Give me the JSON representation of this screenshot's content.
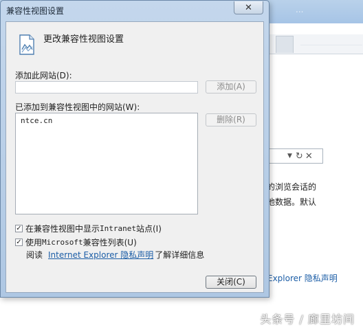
{
  "dialog": {
    "title": "兼容性视图设置",
    "close_icon": "close-icon",
    "header_icon": "document-icon",
    "header_text": "更改兼容性视图设置",
    "add_site_label": "添加此网站(D):",
    "add_site_value": "",
    "add_button": "添加(A)",
    "list_label": "已添加到兼容性视图中的网站(W):",
    "sites": [
      "ntce.cn"
    ],
    "remove_button": "删除(R)",
    "check_intranet": {
      "checked": true,
      "text_a": "在兼容性视图中显示 ",
      "text_mono": "Intranet",
      "text_b": " 站点(I)"
    },
    "check_ms_list": {
      "checked": true,
      "text_a": "使用 ",
      "text_mono": "Microsoft",
      "text_b": " 兼容性列表(U)"
    },
    "read_prefix": "阅读",
    "read_link": "Internet Explorer 隐私声明",
    "read_suffix": "了解详细信息",
    "close_button": "关闭(C)"
  },
  "background": {
    "title_faint": "...",
    "address_icons": [
      "dropdown-arrow-icon",
      "refresh-icon",
      "close-icon"
    ],
    "text_line_1": "的浏览会话的",
    "text_line_2": "他数据。默认",
    "link_text": "Explorer 隐私声明"
  },
  "watermark": "头条号 / 廊里坊间",
  "colors": {
    "link": "#1b5da6",
    "title_bar": "#b9d1ea"
  }
}
